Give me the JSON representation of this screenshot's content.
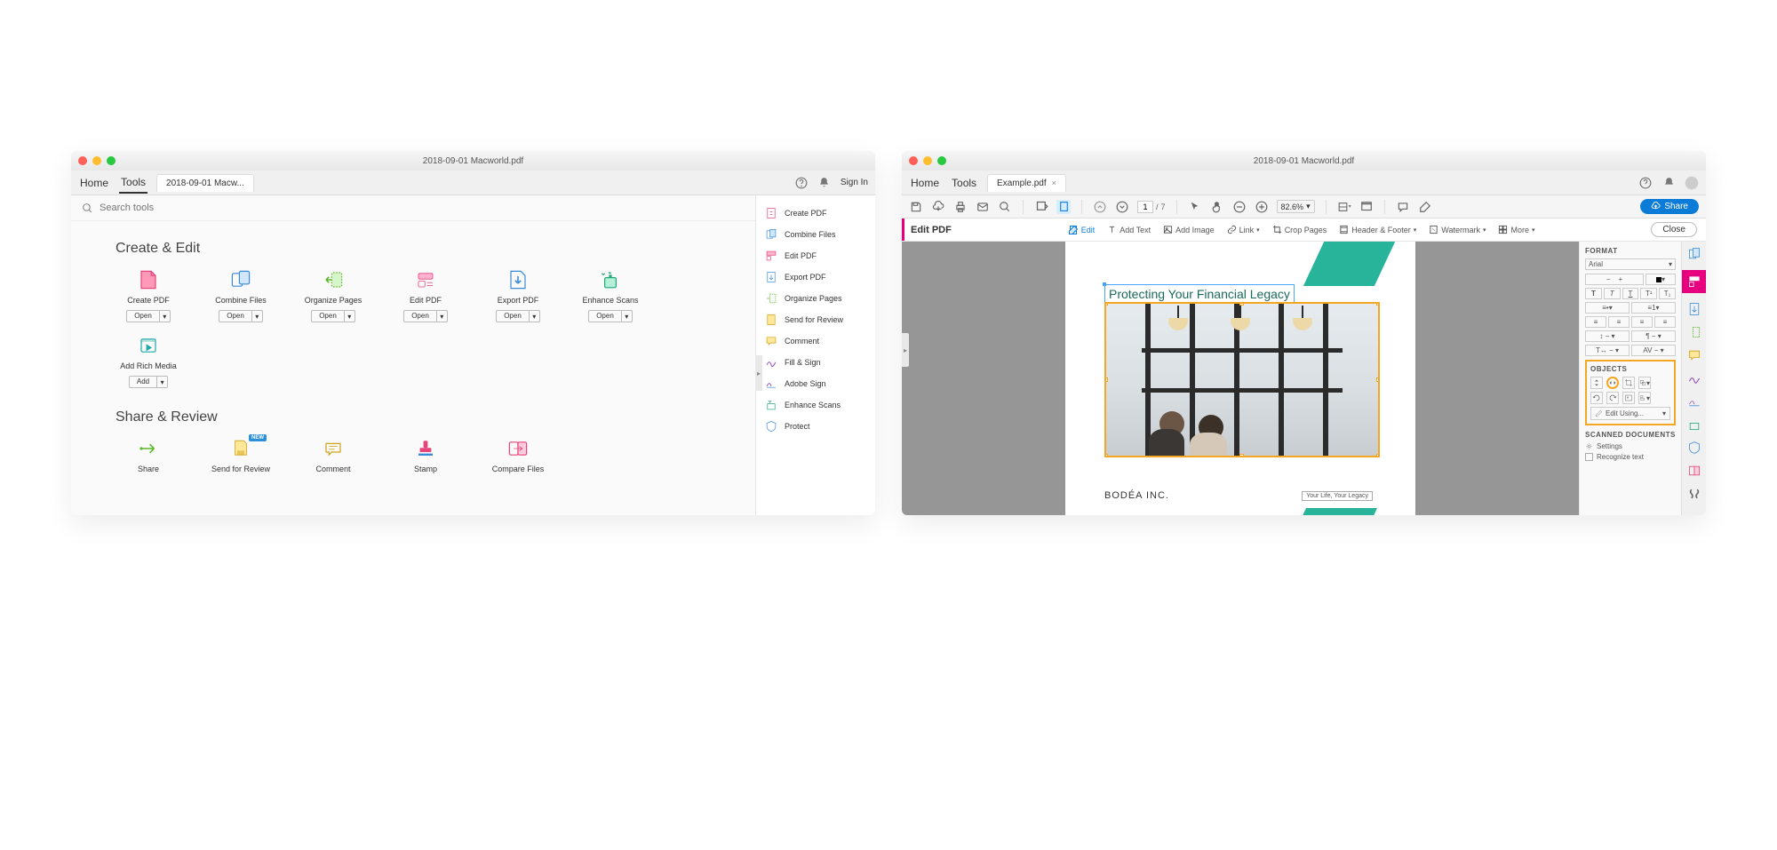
{
  "left": {
    "title": "2018-09-01 Macworld.pdf",
    "nav": {
      "home": "Home",
      "tools": "Tools"
    },
    "tab": "2018-09-01 Macw...",
    "signin": "Sign In",
    "search_placeholder": "Search tools",
    "sec1": "Create & Edit",
    "sec2": "Share & Review",
    "tools1": [
      {
        "label": "Create PDF",
        "btn": "Open"
      },
      {
        "label": "Combine Files",
        "btn": "Open"
      },
      {
        "label": "Organize Pages",
        "btn": "Open"
      },
      {
        "label": "Edit PDF",
        "btn": "Open"
      },
      {
        "label": "Export PDF",
        "btn": "Open"
      },
      {
        "label": "Enhance Scans",
        "btn": "Open"
      },
      {
        "label": "Add Rich Media",
        "btn": "Add"
      }
    ],
    "tools2": [
      {
        "label": "Share"
      },
      {
        "label": "Send for Review",
        "badge": "NEW"
      },
      {
        "label": "Comment"
      },
      {
        "label": "Stamp"
      },
      {
        "label": "Compare Files"
      }
    ],
    "sidebar": [
      "Create PDF",
      "Combine Files",
      "Edit PDF",
      "Export PDF",
      "Organize Pages",
      "Send for Review",
      "Comment",
      "Fill & Sign",
      "Adobe Sign",
      "Enhance Scans",
      "Protect"
    ]
  },
  "right": {
    "title": "2018-09-01 Macworld.pdf",
    "nav": {
      "home": "Home",
      "tools": "Tools"
    },
    "tab": "Example.pdf",
    "page_current": "1",
    "page_sep": "/",
    "page_total": "7",
    "zoom": "82.6%",
    "share": "Share",
    "editbar": {
      "title": "Edit PDF",
      "edit": "Edit",
      "addtext": "Add Text",
      "addimage": "Add Image",
      "link": "Link",
      "crop": "Crop Pages",
      "header": "Header & Footer",
      "watermark": "Watermark",
      "more": "More",
      "close": "Close"
    },
    "doc": {
      "heading": "Protecting Your Financial Legacy",
      "company": "BODÉA INC.",
      "tagline": "Your Life, Your Legacy"
    },
    "format": {
      "title": "FORMAT",
      "font": "Arial",
      "objects": "OBJECTS",
      "editusing": "Edit Using...",
      "scanned": "SCANNED DOCUMENTS",
      "settings": "Settings",
      "recognize": "Recognize text"
    }
  }
}
